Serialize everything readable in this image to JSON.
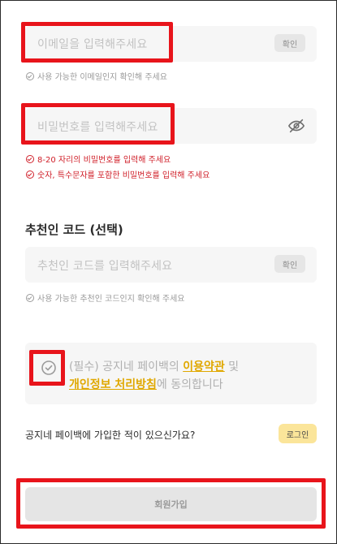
{
  "email": {
    "placeholder": "이메일을 입력해주세요",
    "confirm_label": "확인",
    "hint": "사용 가능한 이메일인지 확인해 주세요"
  },
  "password": {
    "placeholder": "비밀번호를 입력해주세요",
    "errors": [
      "8-20 자리의 비밀번호를 입력해 주세요",
      "숫자, 특수문자를 포함한 비밀번호를 입력해 주세요"
    ]
  },
  "referral": {
    "title": "추천인 코드 (선택)",
    "placeholder": "추천인 코드를 입력해주세요",
    "confirm_label": "확인",
    "hint": "사용 가능한 추천인 코드인지 확인해 주세요"
  },
  "agreement": {
    "prefix": "(필수) 공지네 페이백의 ",
    "terms_link": "이용약관",
    "middle": " 및",
    "privacy_link": "개인정보 처리방침",
    "suffix": "에 동의합니다"
  },
  "login_prompt": {
    "question": "공지네 페이백에 가입한 적이 있으신가요?",
    "login_label": "로그인"
  },
  "signup_label": "회원가입",
  "colors": {
    "highlight": "#e8141b",
    "link": "#e0a800",
    "error": "#d0202a",
    "login_bg": "#fbe59a"
  }
}
